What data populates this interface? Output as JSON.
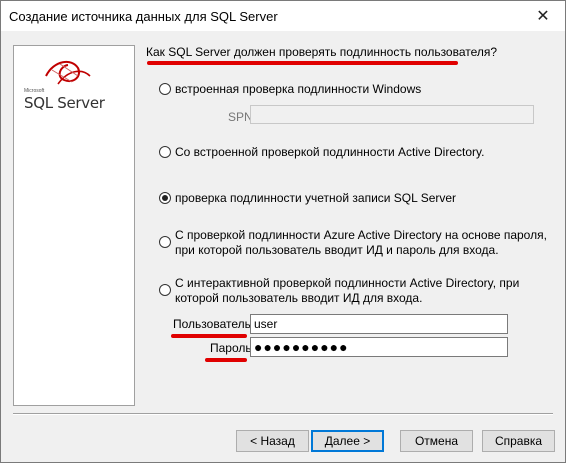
{
  "window": {
    "title": "Создание источника данных для SQL Server",
    "close_icon": "✕"
  },
  "logo": {
    "small": "Microsoft",
    "text": "SQL Server"
  },
  "question": "Как SQL Server должен проверять подлинность пользователя?",
  "auth_options": [
    {
      "label": "встроенная проверка подлинности Windows",
      "checked": false
    },
    {
      "label": "Со встроенной проверкой подлинности Active Directory.",
      "checked": false
    },
    {
      "label": "проверка подлинности учетной записи SQL Server",
      "checked": true
    },
    {
      "label_line1": "С проверкой подлинности Azure Active Directory на основе пароля,",
      "label_line2": "при которой пользователь вводит ИД и пароль для входа.",
      "checked": false
    },
    {
      "label_line1": "С интерактивной проверкой подлинности Active Directory, при",
      "label_line2": "которой пользователь вводит ИД для входа.",
      "checked": false
    }
  ],
  "spn": {
    "label": "SPN:",
    "value": ""
  },
  "login": {
    "label": "Пользователь:",
    "value": "user"
  },
  "password": {
    "label": "Пароль:",
    "value": "●●●●●●●●●●"
  },
  "buttons": {
    "back": "< Назад",
    "next": "Далее >",
    "cancel": "Отмена",
    "help": "Справка"
  },
  "colors": {
    "annotation": "#e00000",
    "default_button_border": "#0078d7"
  }
}
